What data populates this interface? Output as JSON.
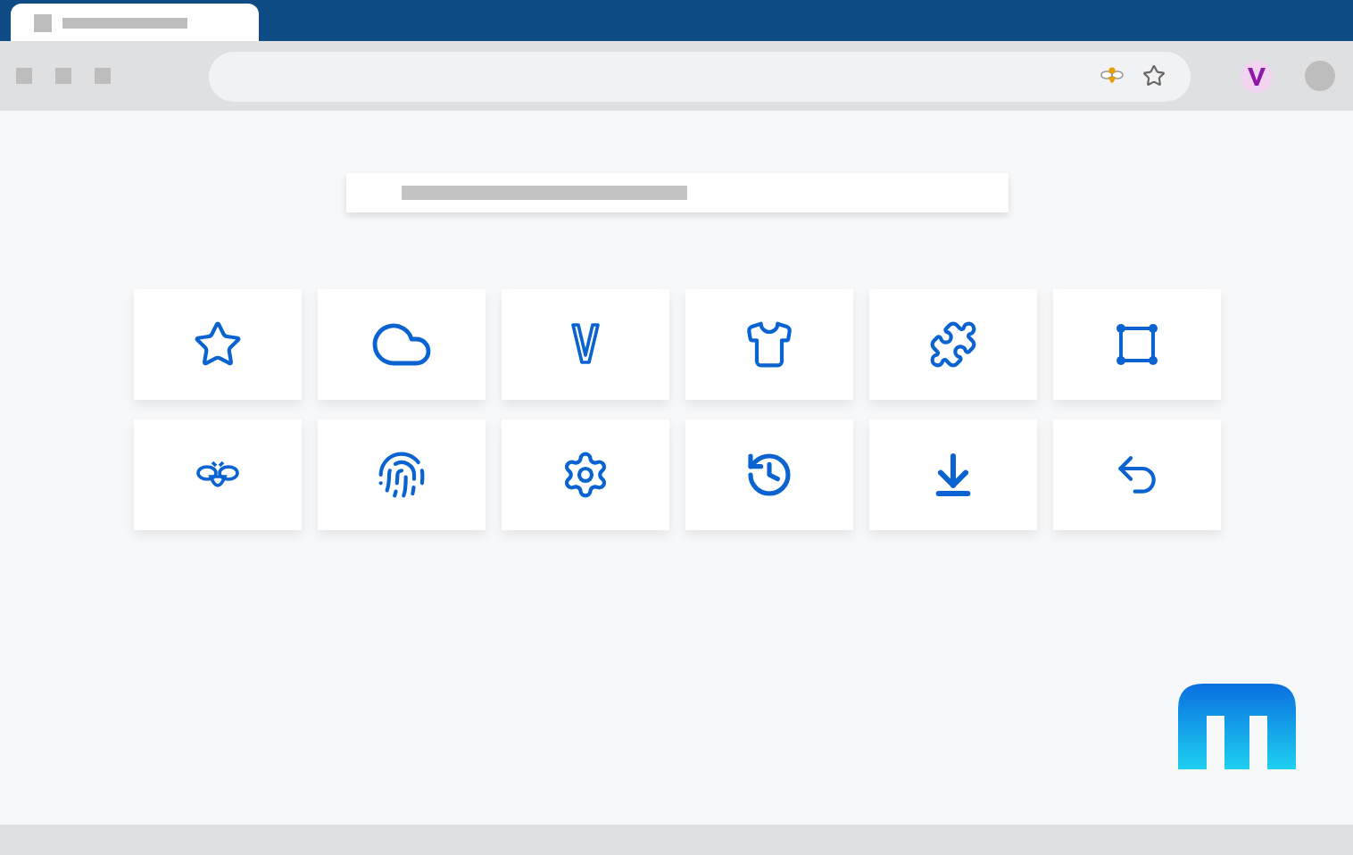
{
  "tabs": [
    {
      "selected": true
    }
  ],
  "tiles": [
    {
      "kind": "star"
    },
    {
      "kind": "cloud"
    },
    {
      "kind": "v"
    },
    {
      "kind": "shirt"
    },
    {
      "kind": "puzzle"
    },
    {
      "kind": "crop"
    },
    {
      "kind": "bee"
    },
    {
      "kind": "fingerprint"
    },
    {
      "kind": "settings"
    },
    {
      "kind": "history"
    },
    {
      "kind": "download"
    },
    {
      "kind": "undo"
    }
  ]
}
